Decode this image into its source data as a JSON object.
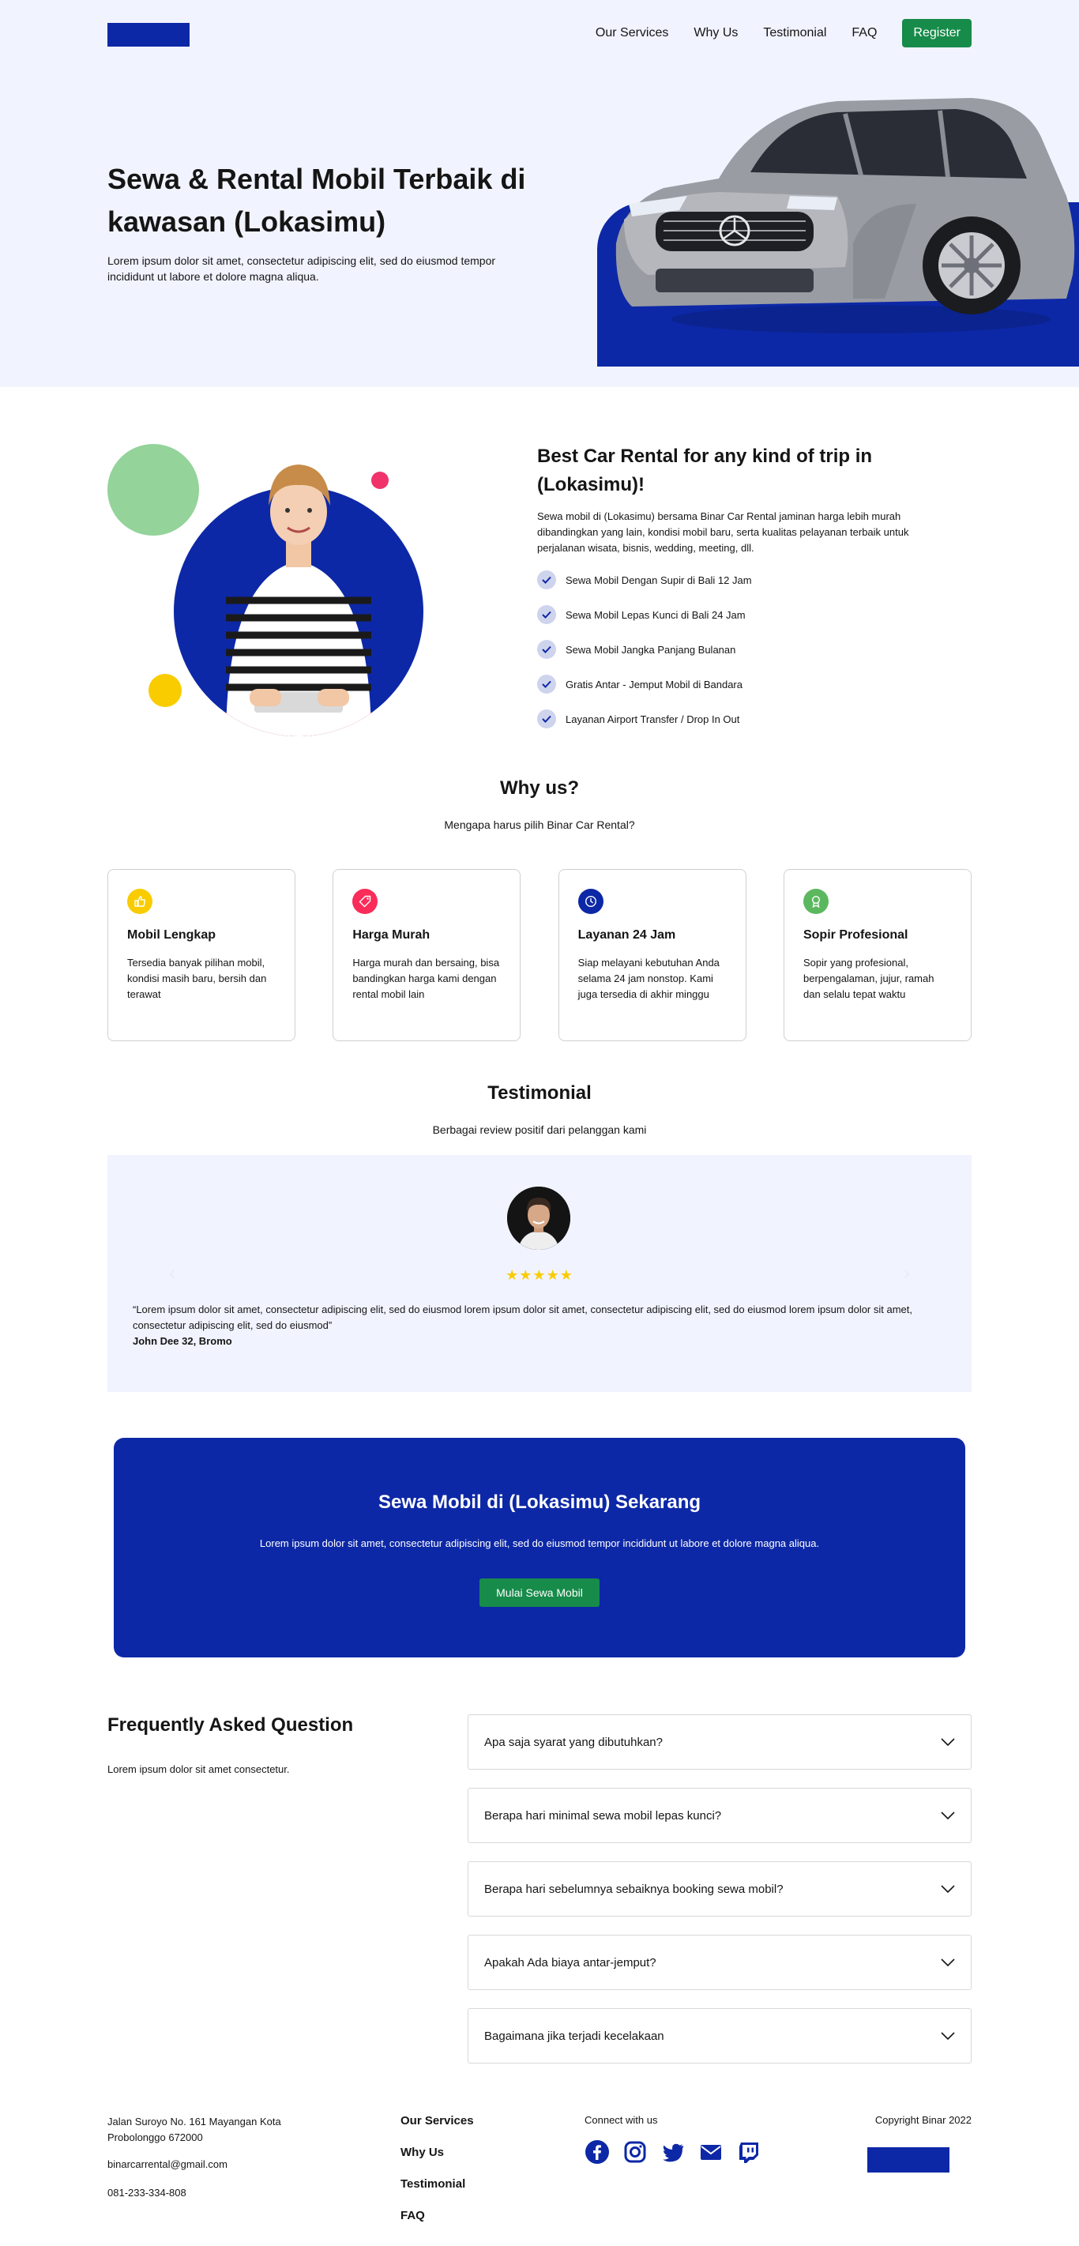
{
  "nav": {
    "items": [
      "Our Services",
      "Why Us",
      "Testimonial",
      "FAQ"
    ],
    "register_label": "Register"
  },
  "hero": {
    "title": "Sewa & Rental Mobil Terbaik di kawasan (Lokasimu)",
    "description": "Lorem ipsum dolor sit amet, consectetur adipiscing elit, sed do eiusmod tempor incididunt ut labore et dolore magna aliqua."
  },
  "services": {
    "title": "Best Car Rental for any kind of trip in (Lokasimu)!",
    "description": "Sewa mobil di (Lokasimu) bersama Binar Car Rental jaminan harga lebih murah dibandingkan yang lain, kondisi mobil baru, serta kualitas pelayanan terbaik untuk perjalanan wisata, bisnis, wedding, meeting, dll.",
    "items": [
      "Sewa Mobil Dengan Supir di Bali 12 Jam",
      "Sewa Mobil Lepas Kunci di Bali 24 Jam",
      "Sewa Mobil Jangka Panjang Bulanan",
      "Gratis Antar - Jemput Mobil di Bandara",
      "Layanan Airport Transfer / Drop In Out"
    ]
  },
  "why_us": {
    "title": "Why us?",
    "subtitle": "Mengapa harus pilih Binar Car Rental?",
    "cards": [
      {
        "icon": "thumbs-up-icon",
        "color": "#f9cc00",
        "title": "Mobil Lengkap",
        "text": "Tersedia banyak pilihan mobil, kondisi masih baru, bersih dan terawat"
      },
      {
        "icon": "price-tag-icon",
        "color": "#fa2c5a",
        "title": "Harga Murah",
        "text": "Harga murah dan bersaing, bisa bandingkan harga kami dengan rental mobil lain"
      },
      {
        "icon": "clock-icon",
        "color": "#0d28a6",
        "title": "Layanan 24 Jam",
        "text": "Siap melayani kebutuhan Anda selama 24 jam nonstop. Kami juga tersedia di akhir minggu"
      },
      {
        "icon": "award-icon",
        "color": "#5cb85f",
        "title": "Sopir Profesional",
        "text": "Sopir yang profesional, berpengalaman, jujur, ramah dan selalu tepat waktu"
      }
    ]
  },
  "testimonial": {
    "title": "Testimonial",
    "subtitle": "Berbagai review positif dari pelanggan kami",
    "stars": "★★★★★",
    "quote": "“Lorem ipsum dolor sit amet, consectetur adipiscing elit, sed do eiusmod lorem ipsum dolor sit amet, consectetur adipiscing elit, sed do eiusmod lorem ipsum dolor sit amet, consectetur adipiscing elit, sed do eiusmod”",
    "name": "John Dee 32, Bromo"
  },
  "cta": {
    "title": "Sewa Mobil di (Lokasimu) Sekarang",
    "description": "Lorem ipsum dolor sit amet, consectetur adipiscing elit, sed do eiusmod tempor incididunt ut labore et dolore magna aliqua.",
    "button_label": "Mulai Sewa Mobil"
  },
  "faq": {
    "title": "Frequently Asked Question",
    "subtitle": "Lorem ipsum dolor sit amet consectetur.",
    "questions": [
      "Apa saja syarat yang dibutuhkan?",
      "Berapa hari minimal sewa mobil lepas kunci?",
      "Berapa hari sebelumnya sebaiknya booking sewa mobil?",
      "Apakah Ada biaya antar-jemput?",
      "Bagaimana jika terjadi kecelakaan"
    ]
  },
  "footer": {
    "address": "Jalan Suroyo No. 161 Mayangan Kota Probolonggo 672000",
    "email": "binarcarrental@gmail.com",
    "phone": "081-233-334-808",
    "nav": [
      "Our Services",
      "Why Us",
      "Testimonial",
      "FAQ"
    ],
    "connect_label": "Connect with us",
    "social_icons": [
      "facebook-icon",
      "instagram-icon",
      "twitter-icon",
      "mail-icon",
      "twitch-icon"
    ],
    "copyright": "Copyright Binar 2022"
  },
  "colors": {
    "brand_blue": "#0d28a6",
    "brand_green": "#178b4a",
    "hero_bg": "#f1f3ff",
    "star_yellow": "#f9cc00"
  }
}
